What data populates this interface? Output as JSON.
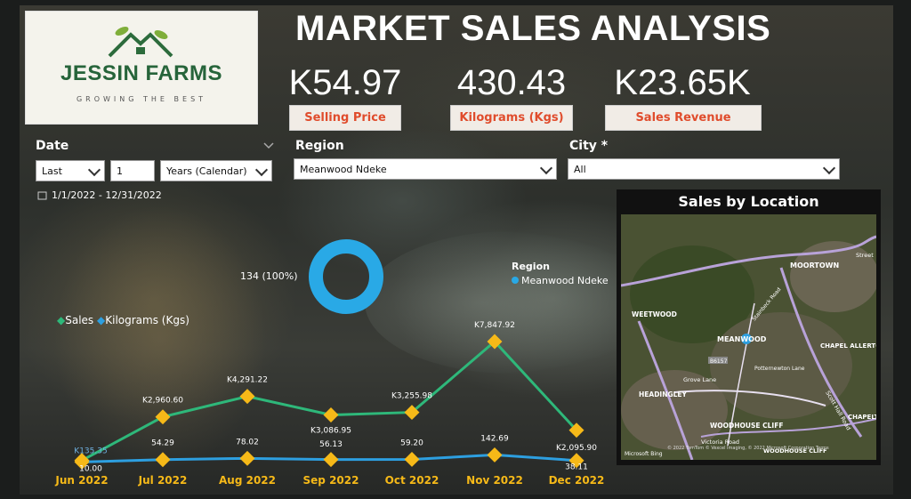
{
  "logo": {
    "brand": "JESSIN FARMS",
    "tagline": "GROWING THE BEST",
    "icon": "house-leaf-icon"
  },
  "header": {
    "title": "MARKET SALES ANALYSIS"
  },
  "kpis": [
    {
      "value": "K54.97",
      "label": "Selling Price"
    },
    {
      "value": "430.43",
      "label": "Kilograms (Kgs)"
    },
    {
      "value": "K23.65K",
      "label": "Sales Revenue"
    }
  ],
  "filters": {
    "date": {
      "label": "Date",
      "mode": "Last",
      "count": "1",
      "unit": "Years (Calendar)",
      "range": "1/1/2022 - 12/31/2022"
    },
    "region": {
      "label": "Region",
      "value": "Meanwood Ndeke"
    },
    "city": {
      "label": "City *",
      "value": "All"
    }
  },
  "donut": {
    "label": "134 (100%)",
    "legend_title": "Region",
    "legend_item": "Meanwood Ndeke",
    "color": "#29a9e6"
  },
  "map": {
    "title": "Sales by Location",
    "places": [
      "MOORTOWN",
      "WEETWOOD",
      "MEANWOOD",
      "CHAPEL ALLERTON",
      "HEADINGLEY",
      "WOODHOUSE CLIFF",
      "CHAPELT",
      "WOODHOUSE CLIFF",
      "Grove Lane",
      "Victoria Road",
      "Scott Hall Road",
      "Street",
      "Potternewton Lane",
      "Stainbeck Road"
    ],
    "badge": "B6157",
    "footer": "© 2022 TomTom © Vexcel Imaging, © 2022 Microsoft Corporation Terms",
    "brand": "Microsoft Bing"
  },
  "chart_data": {
    "type": "line",
    "categories": [
      "Jun 2022",
      "Jul 2022",
      "Aug 2022",
      "Sep 2022",
      "Oct 2022",
      "Nov 2022",
      "Dec 2022"
    ],
    "series": [
      {
        "name": "Sales",
        "color": "#2eb87a",
        "values": [
          135.35,
          2960.6,
          4291.22,
          3086.95,
          3255.98,
          7847.92,
          2095.9
        ],
        "labels": [
          "K135.35",
          "K2,960.60",
          "K4,291.22",
          "K3,086.95",
          "K3,255.98",
          "K7,847.92",
          "K2,095.90"
        ]
      },
      {
        "name": "Kilograms (Kgs)",
        "color": "#2d9fe0",
        "values": [
          10.0,
          54.29,
          78.02,
          56.13,
          59.2,
          142.69,
          38.11
        ],
        "labels": [
          "10.00",
          "54.29",
          "78.02",
          "56.13",
          "59.20",
          "142.69",
          "38.11"
        ]
      }
    ],
    "ylim": [
      0,
      8000
    ]
  }
}
